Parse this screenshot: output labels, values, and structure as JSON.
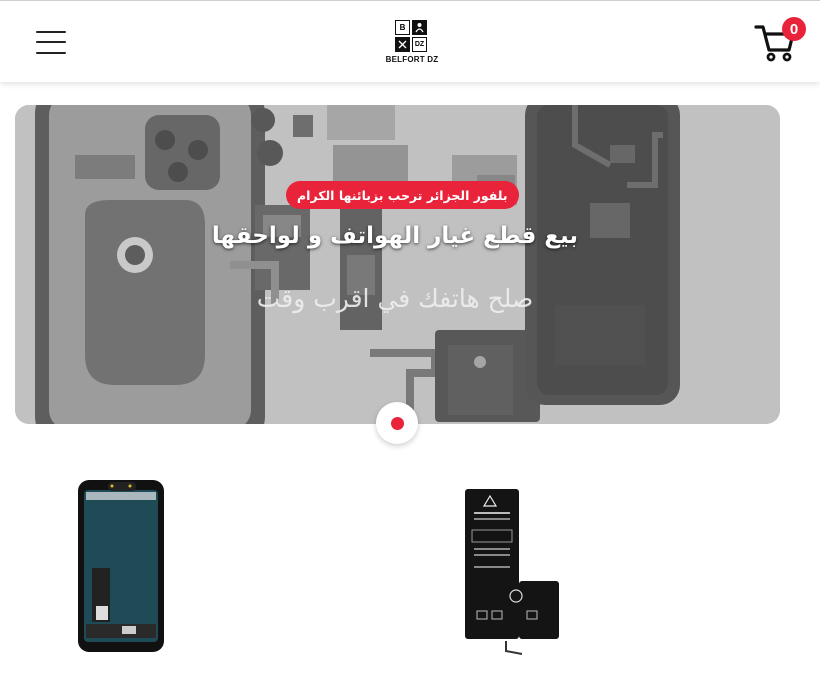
{
  "header": {
    "menu_icon": "hamburger-menu-icon",
    "logo": {
      "cells": [
        "B",
        "",
        "",
        "DZ"
      ],
      "name": "BELFORT DZ"
    },
    "cart": {
      "icon": "cart-icon",
      "count": "0"
    }
  },
  "hero": {
    "tag": "بلفور الجزائر ترحب بزبائنها الكرام",
    "title": "بيع قطع غيار الهواتف و لواحقها",
    "subtitle": "صلح هاتفك في اقرب وقت",
    "active_slide": 1,
    "accent": "#e8233a"
  },
  "products": [
    {
      "name": "screen-product",
      "image": "phone-screen"
    },
    {
      "name": "battery-product",
      "image": "phone-battery"
    }
  ]
}
